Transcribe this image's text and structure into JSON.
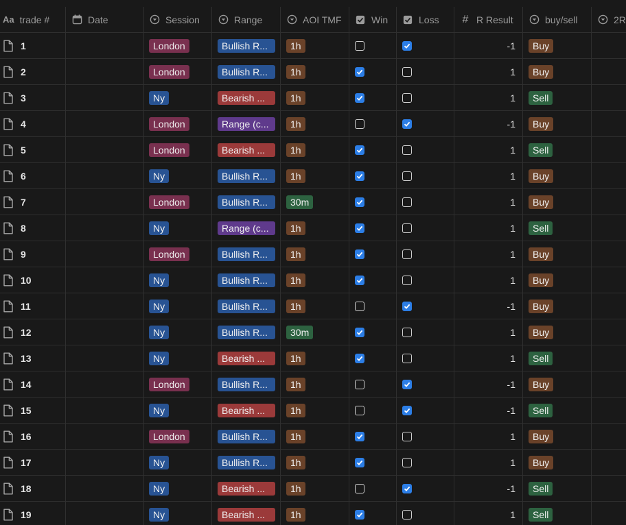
{
  "columns": {
    "name": "trade #",
    "name_icon": "Aa",
    "date": "Date",
    "session": "Session",
    "range": "Range",
    "aoi": "AOI TMF",
    "win": "Win",
    "loss": "Loss",
    "r_result": "R Result",
    "r_icon": "#",
    "buy_sell": "buy/sell",
    "extra": "2R"
  },
  "rows": [
    {
      "name": "1",
      "session": "London",
      "range": "Bullish R...",
      "aoi": "1h",
      "win": false,
      "loss": true,
      "r": "-1",
      "bs": "Buy"
    },
    {
      "name": "2",
      "session": "London",
      "range": "Bullish R...",
      "aoi": "1h",
      "win": true,
      "loss": false,
      "r": "1",
      "bs": "Buy"
    },
    {
      "name": "3",
      "session": "Ny",
      "range": "Bearish ...",
      "aoi": "1h",
      "win": true,
      "loss": false,
      "r": "1",
      "bs": "Sell"
    },
    {
      "name": "4",
      "session": "London",
      "range": "Range (c...",
      "aoi": "1h",
      "win": false,
      "loss": true,
      "r": "-1",
      "bs": "Buy"
    },
    {
      "name": "5",
      "session": "London",
      "range": "Bearish ...",
      "aoi": "1h",
      "win": true,
      "loss": false,
      "r": "1",
      "bs": "Sell"
    },
    {
      "name": "6",
      "session": "Ny",
      "range": "Bullish R...",
      "aoi": "1h",
      "win": true,
      "loss": false,
      "r": "1",
      "bs": "Buy"
    },
    {
      "name": "7",
      "session": "London",
      "range": "Bullish R...",
      "aoi": "30m",
      "win": true,
      "loss": false,
      "r": "1",
      "bs": "Buy"
    },
    {
      "name": "8",
      "session": "Ny",
      "range": "Range (c...",
      "aoi": "1h",
      "win": true,
      "loss": false,
      "r": "1",
      "bs": "Sell"
    },
    {
      "name": "9",
      "session": "London",
      "range": "Bullish R...",
      "aoi": "1h",
      "win": true,
      "loss": false,
      "r": "1",
      "bs": "Buy"
    },
    {
      "name": "10",
      "session": "Ny",
      "range": "Bullish R...",
      "aoi": "1h",
      "win": true,
      "loss": false,
      "r": "1",
      "bs": "Buy"
    },
    {
      "name": "11",
      "session": "Ny",
      "range": "Bullish R...",
      "aoi": "1h",
      "win": false,
      "loss": true,
      "r": "-1",
      "bs": "Buy"
    },
    {
      "name": "12",
      "session": "Ny",
      "range": "Bullish R...",
      "aoi": "30m",
      "win": true,
      "loss": false,
      "r": "1",
      "bs": "Buy"
    },
    {
      "name": "13",
      "session": "Ny",
      "range": "Bearish ...",
      "aoi": "1h",
      "win": true,
      "loss": false,
      "r": "1",
      "bs": "Sell"
    },
    {
      "name": "14",
      "session": "London",
      "range": "Bullish R...",
      "aoi": "1h",
      "win": false,
      "loss": true,
      "r": "-1",
      "bs": "Buy"
    },
    {
      "name": "15",
      "session": "Ny",
      "range": "Bearish ...",
      "aoi": "1h",
      "win": false,
      "loss": true,
      "r": "-1",
      "bs": "Sell"
    },
    {
      "name": "16",
      "session": "London",
      "range": "Bullish R...",
      "aoi": "1h",
      "win": true,
      "loss": false,
      "r": "1",
      "bs": "Buy"
    },
    {
      "name": "17",
      "session": "Ny",
      "range": "Bullish R...",
      "aoi": "1h",
      "win": true,
      "loss": false,
      "r": "1",
      "bs": "Buy"
    },
    {
      "name": "18",
      "session": "Ny",
      "range": "Bearish ...",
      "aoi": "1h",
      "win": false,
      "loss": true,
      "r": "-1",
      "bs": "Sell"
    },
    {
      "name": "19",
      "session": "Ny",
      "range": "Bearish ...",
      "aoi": "1h",
      "win": true,
      "loss": false,
      "r": "1",
      "bs": "Sell"
    }
  ],
  "colors": {
    "background": "#191919",
    "tag_london": "#79304f",
    "tag_ny": "#285393",
    "tag_bullish": "#285393",
    "tag_bearish": "#9b3a3a",
    "tag_range": "#5f3a8c",
    "tag_1h": "#6a4229",
    "tag_30m": "#2d6240",
    "tag_buy": "#6a4229",
    "tag_sell": "#2d6240",
    "checkbox_checked": "#2c7ee6"
  }
}
